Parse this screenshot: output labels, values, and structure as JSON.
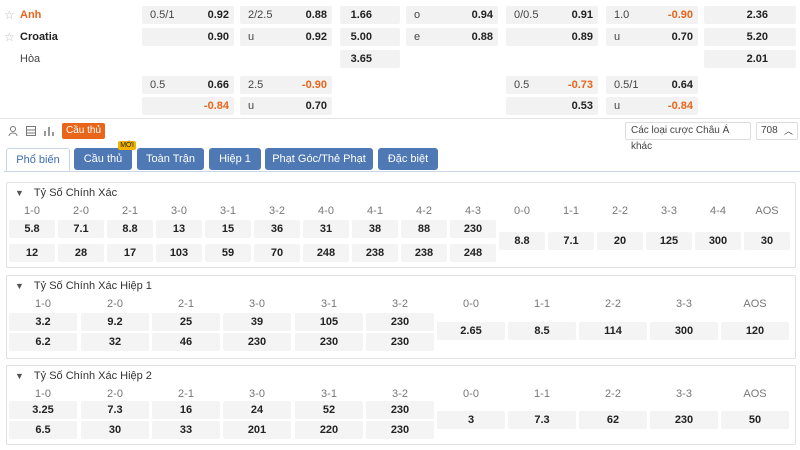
{
  "teams": {
    "home": "Anh",
    "away": "Croatia",
    "draw": "Hòa"
  },
  "icons": {
    "star": "star-icon",
    "stats": "bar-chart-icon",
    "list": "list-icon",
    "player": "player-icon",
    "chevron": "chevron-down-icon"
  },
  "top_odds": {
    "row1": [
      "0.5/1",
      "0.92",
      "2/2.5",
      "0.88",
      "1.66",
      "o",
      "0.94",
      "0/0.5",
      "0.91",
      "1.0",
      "-0.90",
      "2.36"
    ],
    "row2": [
      "0.90",
      "u",
      "0.92",
      "5.00",
      "e",
      "0.88",
      "0.89",
      "u",
      "0.70",
      "5.20"
    ],
    "row3": [
      "3.65",
      "2.01"
    ],
    "row4": [
      "0.5",
      "0.66",
      "2.5",
      "-0.90",
      "0.5",
      "-0.73",
      "0.5/1",
      "0.64"
    ],
    "row5": [
      "-0.84",
      "u",
      "0.70",
      "0.53",
      "u",
      "-0.84"
    ]
  },
  "toolbar": {
    "player_tag": "Cầu thủ",
    "select_label": "Các loại cược Châu Á khác",
    "count": "708"
  },
  "tabs": [
    "Phổ biến",
    "Cầu thủ",
    "Toàn Trận",
    "Hiệp 1",
    "Phạt Góc/Thẻ Phạt",
    "Đặc biệt"
  ],
  "new_badge": "MỚI",
  "sections": [
    {
      "title": "Tỷ Số Chính Xác",
      "labels": [
        "1-0",
        "2-0",
        "2-1",
        "3-0",
        "3-1",
        "3-2",
        "4-0",
        "4-1",
        "4-2",
        "4-3",
        "0-0",
        "1-1",
        "2-2",
        "3-3",
        "4-4",
        "AOS"
      ],
      "home": [
        "5.8",
        "7.1",
        "8.8",
        "13",
        "15",
        "36",
        "31",
        "38",
        "88",
        "230"
      ],
      "away": [
        "12",
        "28",
        "17",
        "103",
        "59",
        "70",
        "248",
        "238",
        "238",
        "248"
      ],
      "draw": [
        "8.8",
        "7.1",
        "20",
        "125",
        "300",
        "30"
      ]
    },
    {
      "title": "Tỷ Số Chính Xác Hiệp 1",
      "labels": [
        "1-0",
        "2-0",
        "2-1",
        "3-0",
        "3-1",
        "3-2",
        "0-0",
        "1-1",
        "2-2",
        "3-3",
        "AOS"
      ],
      "home": [
        "3.2",
        "9.2",
        "25",
        "39",
        "105",
        "230"
      ],
      "away": [
        "6.2",
        "32",
        "46",
        "230",
        "230",
        "230"
      ],
      "draw": [
        "2.65",
        "8.5",
        "114",
        "300",
        "120"
      ]
    },
    {
      "title": "Tỷ Số Chính Xác Hiệp 2",
      "labels": [
        "1-0",
        "2-0",
        "2-1",
        "3-0",
        "3-1",
        "3-2",
        "0-0",
        "1-1",
        "2-2",
        "3-3",
        "AOS"
      ],
      "home": [
        "3.25",
        "7.3",
        "16",
        "24",
        "52",
        "230"
      ],
      "away": [
        "6.5",
        "30",
        "33",
        "201",
        "220",
        "230"
      ],
      "draw": [
        "3",
        "7.3",
        "62",
        "230",
        "50"
      ]
    }
  ]
}
